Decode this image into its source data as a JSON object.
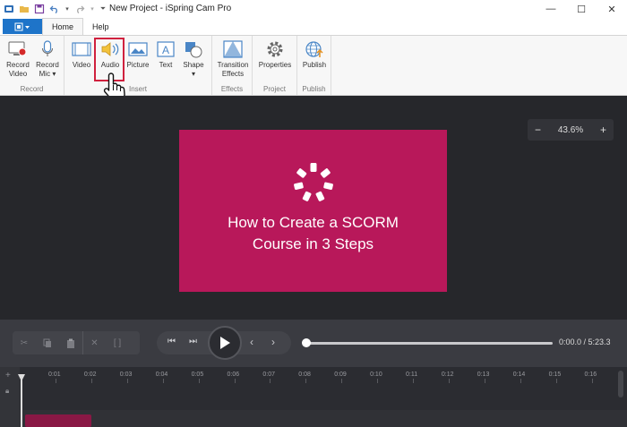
{
  "window": {
    "title": "New Project - iSpring Cam Pro",
    "minimize": "—",
    "maximize": "☐",
    "close": "✕"
  },
  "ribbon_tabs": [
    "Home",
    "Help"
  ],
  "ribbon": {
    "record_video": "Record Video",
    "record_mic": "Record Mic",
    "record_group": "Record",
    "video": "Video",
    "audio": "Audio",
    "picture": "Picture",
    "text": "Text",
    "shape": "Shape",
    "insert_group": "Insert",
    "transition": "Transition Effects",
    "effects_group": "Effects",
    "properties": "Properties",
    "project_group": "Project",
    "publish": "Publish",
    "publish_group": "Publish"
  },
  "slide": {
    "line1": "How to Create a SCORM",
    "line2": "Course in 3 Steps",
    "bg_color": "#b8185a"
  },
  "zoom": {
    "minus": "−",
    "value": "43.6%",
    "plus": "+"
  },
  "playback": {
    "time": "0:00.0 / 5:23.3",
    "progress": 0
  },
  "timeline": {
    "ticks": [
      "0:01",
      "0:02",
      "0:03",
      "0:04",
      "0:05",
      "0:06",
      "0:07",
      "0:08",
      "0:09",
      "0:10",
      "0:11",
      "0:12",
      "0:13",
      "0:14",
      "0:15",
      "0:16"
    ]
  },
  "colors": {
    "accent": "#1e74c9",
    "highlight": "#d0213e",
    "canvas_bg": "#26272b"
  }
}
